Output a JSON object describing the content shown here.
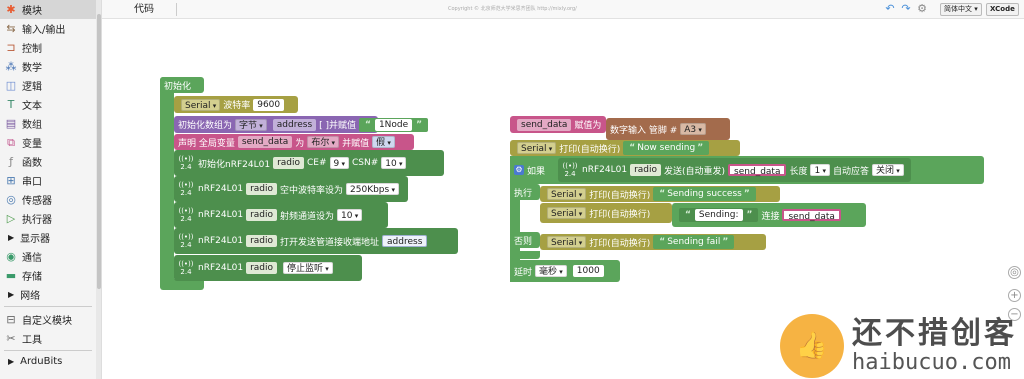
{
  "sidebar": {
    "items": [
      {
        "label": "模块",
        "icon": "puzzle-icon"
      },
      {
        "label": "输入/输出",
        "icon": "io-icon"
      },
      {
        "label": "控制",
        "icon": "control-icon"
      },
      {
        "label": "数学",
        "icon": "math-icon"
      },
      {
        "label": "逻辑",
        "icon": "logic-icon"
      },
      {
        "label": "文本",
        "icon": "text-icon"
      },
      {
        "label": "数组",
        "icon": "array-icon"
      },
      {
        "label": "变量",
        "icon": "variable-icon"
      },
      {
        "label": "函数",
        "icon": "function-icon"
      },
      {
        "label": "串口",
        "icon": "serial-icon"
      },
      {
        "label": "传感器",
        "icon": "sensor-icon"
      },
      {
        "label": "执行器",
        "icon": "actuator-icon"
      },
      {
        "label": "显示器",
        "icon": "triangle-right-icon"
      },
      {
        "label": "通信",
        "icon": "communication-icon"
      },
      {
        "label": "存储",
        "icon": "storage-icon"
      },
      {
        "label": "网络",
        "icon": "triangle-right-icon"
      },
      {
        "label": "自定义模块",
        "icon": "custom-module-icon"
      },
      {
        "label": "工具",
        "icon": "tools-icon"
      },
      {
        "label": "ArduBits",
        "icon": "triangle-right-icon"
      }
    ]
  },
  "topbar": {
    "code_tab": "代码",
    "copyright": "Copyright © 北京师范大学米思齐团队 http://mixly.org/",
    "language": "简体中文",
    "xcode": "XCode"
  },
  "setup_block": {
    "title": "初始化",
    "serial": "Serial",
    "baud_label": "波特率",
    "baud_value": "9600",
    "init_array_label": "初始化数组为",
    "array_type": "字节",
    "array_name": "address",
    "array_brackets": "[ ]并赋值",
    "array_value": "1Node",
    "declare_label": "声明 全局变量",
    "var_name": "send_data",
    "as_label": "为",
    "var_type": "布尔",
    "assign_label": "并赋值",
    "var_value": "假",
    "nrf_init_label": "初始化nRF24L01",
    "radio": "radio",
    "ce_label": "CE#",
    "ce_value": "9",
    "csn_label": "CSN#",
    "csn_value": "10",
    "nrf": "nRF24L01",
    "air_rate_label": "空中波特率设为",
    "air_rate_value": "250Kbps",
    "channel_label": "射频通道设为",
    "channel_value": "10",
    "pipe_label": "打开发送管道",
    "recv_addr_label": "接收端地址",
    "recv_addr_value": "address",
    "stop_listen": "停止监听"
  },
  "loop_block": {
    "var_name": "send_data",
    "assign_label": "赋值为",
    "digital_read_label": "数字输入 管脚 #",
    "pin_value": "A3",
    "serial": "Serial",
    "print_label": "打印",
    "newline_label": "(自动换行)",
    "now_sending": "Now sending",
    "if_label": "如果",
    "nrf": "nRF24L01",
    "radio": "radio",
    "send_label": "发送(自动重发)",
    "send_var": "send_data",
    "length_label": "长度",
    "length_value": "1",
    "auto_ack_label": "自动应答",
    "auto_ack_value": "关闭",
    "do_label": "执行",
    "success_text": "Sending success",
    "sending_text": "Sending:",
    "concat_label": "连接",
    "concat_var": "send_data",
    "else_label": "否则",
    "fail_text": "Sending fail",
    "delay_label": "延时",
    "delay_unit": "毫秒",
    "delay_value": "1000"
  },
  "watermark": {
    "cn": "还不措创客",
    "en": "haibucuo.com"
  }
}
